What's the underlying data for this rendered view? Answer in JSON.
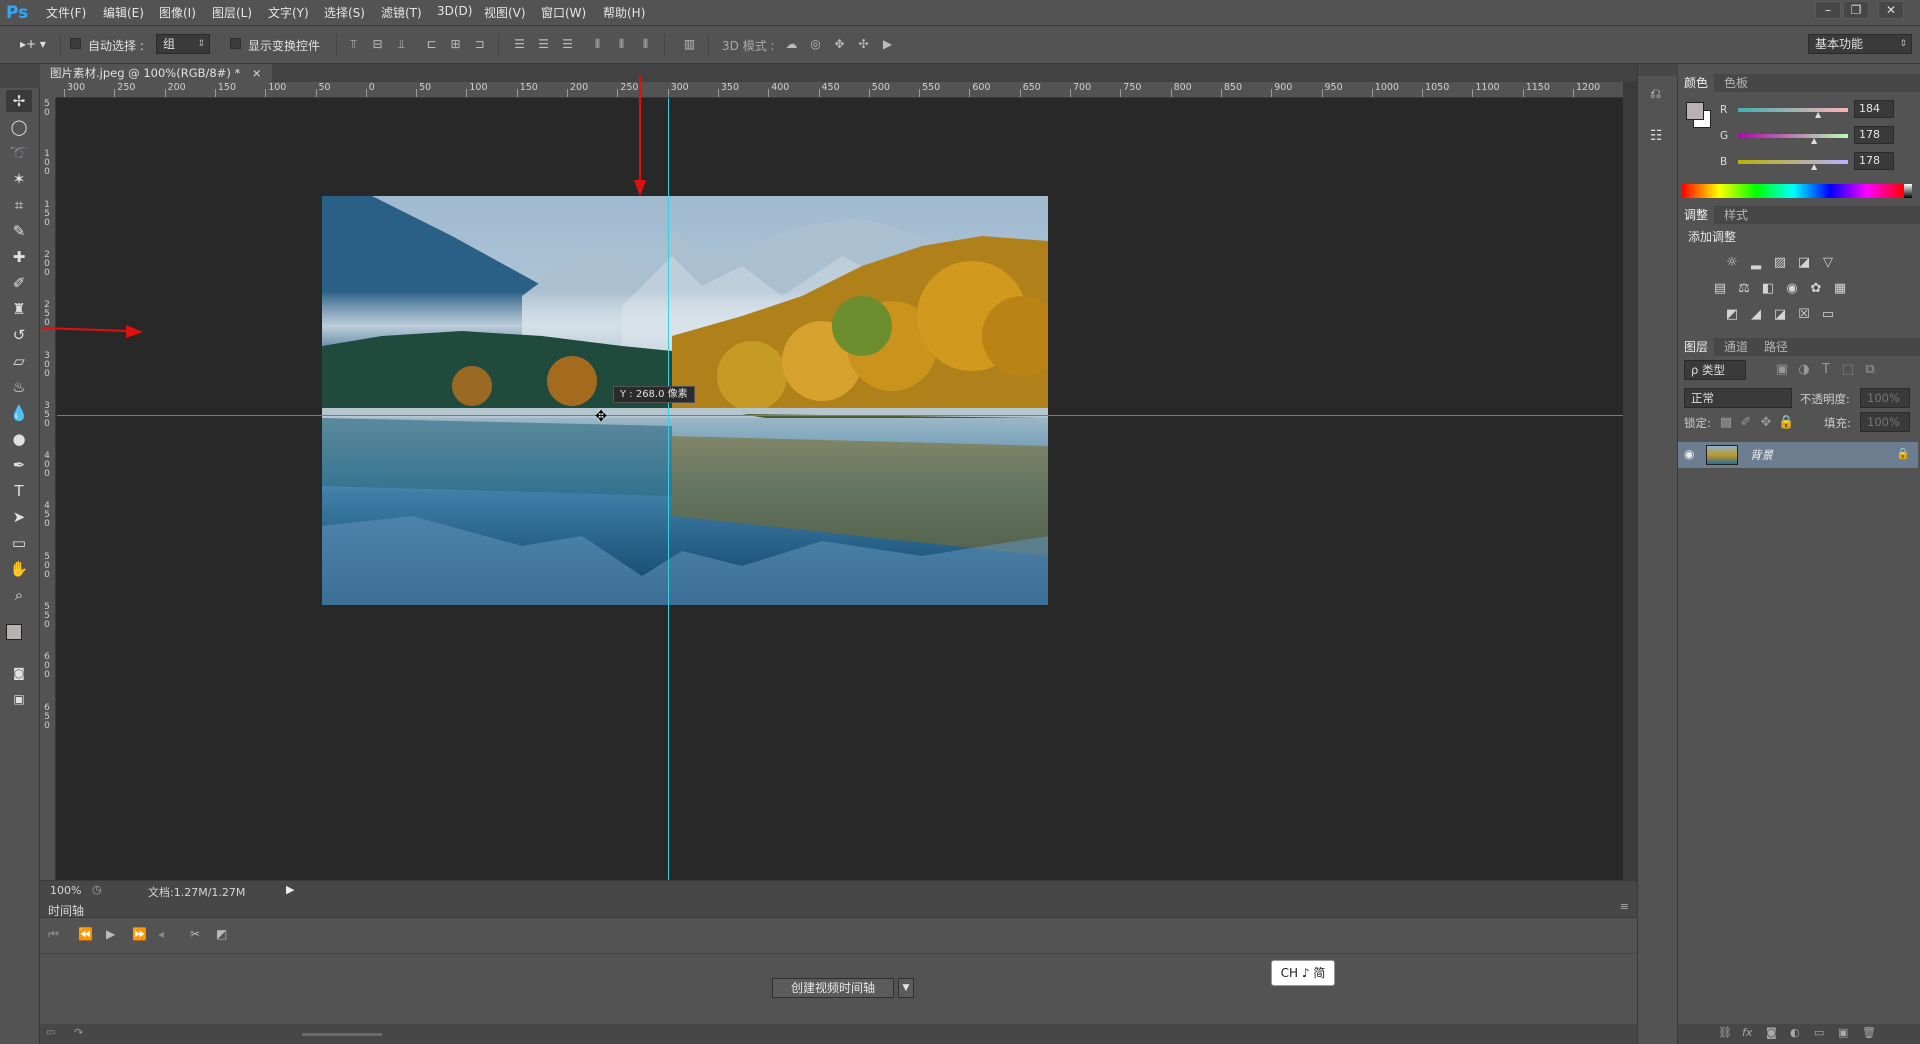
{
  "app": {
    "logo": "Ps"
  },
  "menubar": {
    "items": [
      "文件(F)",
      "编辑(E)",
      "图像(I)",
      "图层(L)",
      "文字(Y)",
      "选择(S)",
      "滤镜(T)",
      "3D(D)",
      "视图(V)",
      "窗口(W)",
      "帮助(H)"
    ],
    "window_controls": [
      "–",
      "❐",
      "✕"
    ]
  },
  "options": {
    "tool_preset": "▸+ ▾",
    "auto_select_label": "自动选择 :",
    "auto_select_value": "组",
    "show_transform_label": "显示变换控件",
    "mode_3d_label": "3D 模式 :",
    "workspace": "基本功能"
  },
  "document": {
    "tab_title": "图片素材.jpeg @ 100%(RGB/8#) *",
    "close": "×",
    "zoom": "100%",
    "doc_info": "文档:1.27M/1.27M",
    "guide_tooltip": "Y : 268.0 像素"
  },
  "rulers": {
    "h_labels": [
      "300",
      "250",
      "200",
      "150",
      "100",
      "50",
      "0",
      "50",
      "100",
      "150",
      "200",
      "250",
      "300",
      "350",
      "400",
      "450",
      "500",
      "550",
      "600",
      "650",
      "700",
      "750",
      "800",
      "850",
      "900",
      "950",
      "1000",
      "1050",
      "1100",
      "1150",
      "1200"
    ],
    "v_labels": [
      "5\n0",
      "1\n0\n0",
      "1\n5\n0",
      "2\n0\n0",
      "2\n5\n0",
      "3\n0\n0",
      "3\n5\n0",
      "4\n0\n0",
      "4\n5\n0",
      "5\n0\n0",
      "5\n5\n0",
      "6\n0\n0",
      "6\n5\n0"
    ]
  },
  "tools": [
    "move-icon",
    "marquee-icon",
    "lasso-icon",
    "magic-wand-icon",
    "crop-icon",
    "eyedropper-icon",
    "healing-icon",
    "brush-icon",
    "stamp-icon",
    "history-brush-icon",
    "eraser-icon",
    "paint-bucket-icon",
    "blur-icon",
    "dodge-icon",
    "pen-icon",
    "type-icon",
    "path-select-icon",
    "rectangle-icon",
    "hand-icon",
    "zoom-icon"
  ],
  "timeline": {
    "title": "时间轴",
    "create_button": "创建视频时间轴",
    "ime_indicator": "CH ♪ 简"
  },
  "panels": {
    "color_tabs": [
      "颜色",
      "色板"
    ],
    "rgb": [
      {
        "label": "R",
        "value": "184"
      },
      {
        "label": "G",
        "value": "178"
      },
      {
        "label": "B",
        "value": "178"
      }
    ],
    "adjust_tabs": [
      "调整",
      "样式"
    ],
    "add_adjustment": "添加调整",
    "layer_tabs": [
      "图层",
      "通道",
      "路径"
    ],
    "layer_filter": "ρ 类型",
    "blend_mode": "正常",
    "opacity_label": "不透明度:",
    "opacity_value": "100%",
    "lock_label": "锁定:",
    "fill_label": "填充:",
    "fill_value": "100%",
    "layer_name": "背景"
  },
  "colors": {
    "accent_guide": "#38cfe5",
    "layer_selected": "#6b7d8f",
    "annotation_arrow": "#e01010"
  }
}
